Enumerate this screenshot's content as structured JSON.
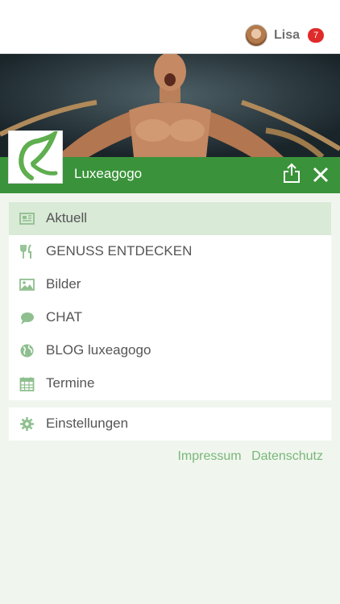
{
  "user": {
    "name": "Lisa",
    "notification_count": "7"
  },
  "brand": {
    "name": "Luxeagogo"
  },
  "menu": {
    "items": [
      {
        "label": "Aktuell",
        "icon": "newspaper-icon",
        "active": true
      },
      {
        "label": "GENUSS ENTDECKEN",
        "icon": "fork-knife-icon"
      },
      {
        "label": "Bilder",
        "icon": "image-icon"
      },
      {
        "label": "CHAT",
        "icon": "chat-bubble-icon"
      },
      {
        "label": "BLOG luxeagogo",
        "icon": "globe-icon"
      },
      {
        "label": "Termine",
        "icon": "calendar-icon"
      }
    ]
  },
  "settings": {
    "label": "Einstellungen",
    "icon": "gear-icon"
  },
  "footer": {
    "impressum": "Impressum",
    "datenschutz": "Datenschutz"
  },
  "colors": {
    "accent": "#3a933a",
    "background": "#f0f6ee",
    "badge": "#e02a2a",
    "link": "#7ab77a",
    "active_item": "#d9ead7"
  }
}
